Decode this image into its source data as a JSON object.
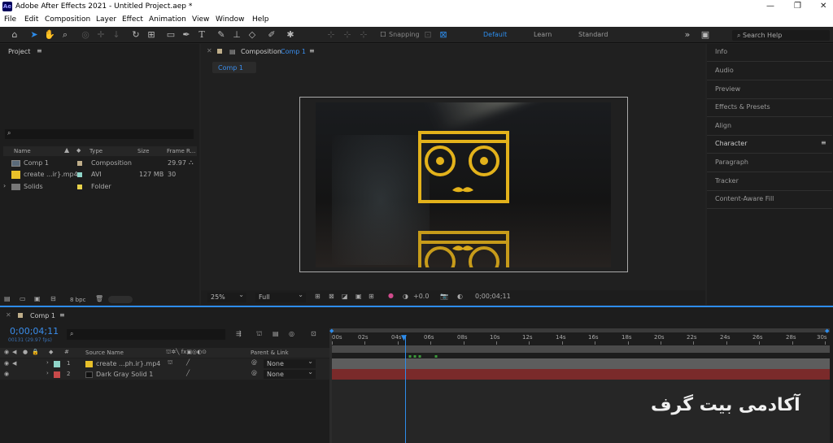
{
  "window": {
    "app_icon": "Ae",
    "title": "Adobe After Effects 2021 - Untitled Project.aep *",
    "minimize": "—",
    "maximize": "❐",
    "close": "✕"
  },
  "menu": [
    "File",
    "Edit",
    "Composition",
    "Layer",
    "Effect",
    "Animation",
    "View",
    "Window",
    "Help"
  ],
  "toolbar": {
    "snapping_label": "Snapping"
  },
  "workspaces": [
    "Default",
    "Learn",
    "Standard"
  ],
  "search_help": {
    "placeholder": "Search Help"
  },
  "project_panel": {
    "title": "Project",
    "columns": {
      "name": "Name",
      "type": "Type",
      "size": "Size",
      "frame_rate": "Frame R..."
    },
    "items": [
      {
        "name": "Comp 1",
        "type": "Composition",
        "size": "",
        "frame_rate": "29.97"
      },
      {
        "name": "create ...ir}.mp4",
        "type": "AVI",
        "size": "127 MB",
        "frame_rate": "30"
      },
      {
        "name": "Solids",
        "type": "Folder",
        "size": "",
        "frame_rate": ""
      }
    ],
    "bpc": "8 bpc"
  },
  "composition_panel": {
    "label": "Composition",
    "comp_name": "Comp 1",
    "tab": "Comp 1",
    "zoom": "25%",
    "resolution": "Full",
    "exposure": "+0.0",
    "timecode": "0;00;04;11"
  },
  "right_panels": [
    "Info",
    "Audio",
    "Preview",
    "Effects & Presets",
    "Align",
    "Character",
    "Paragraph",
    "Tracker",
    "Content-Aware Fill"
  ],
  "timeline": {
    "tab": "Comp 1",
    "timecode": "0;00;04;11",
    "frames": "00131 (29.97 fps)",
    "columns": {
      "source_name": "Source Name",
      "parent": "Parent & Link"
    },
    "layers": [
      {
        "num": "1",
        "name": "create ...ph.ir}.mp4",
        "parent": "None",
        "color": "#8fd4c8"
      },
      {
        "num": "2",
        "name": "Dark Gray Solid 1",
        "parent": "None",
        "color": "#c84a4a"
      }
    ],
    "ruler": [
      "00s",
      "02s",
      "04s",
      "06s",
      "08s",
      "10s",
      "12s",
      "14s",
      "16s",
      "18s",
      "20s",
      "22s",
      "24s",
      "26s",
      "28s",
      "30s"
    ]
  },
  "watermark": "آکادمی بیت گرف"
}
